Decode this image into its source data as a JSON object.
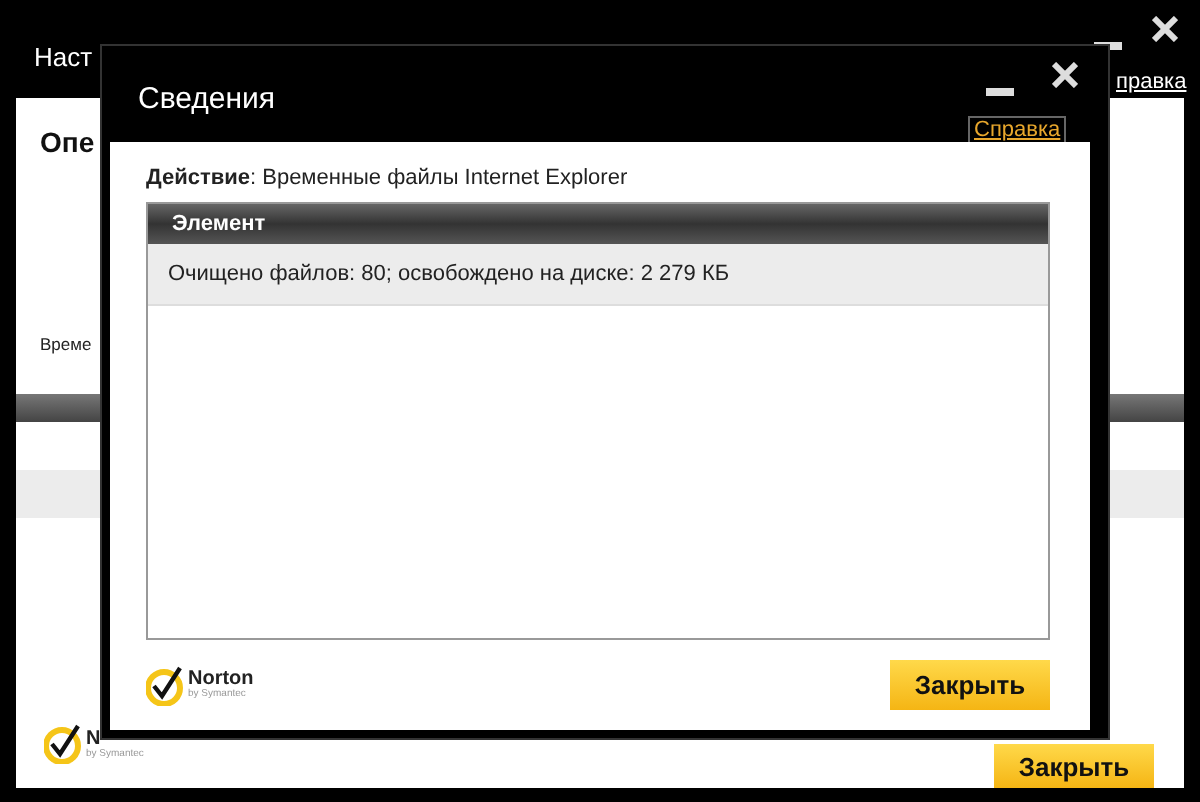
{
  "back_window": {
    "title": "Наст",
    "help_link": "правка",
    "heading": "Опе",
    "caption": "Време",
    "logo": {
      "name": "N",
      "byline": "by Symantec"
    },
    "close_button": "Закрыть"
  },
  "dialog": {
    "title": "Сведения",
    "help_link": "Справка",
    "action_label": "Действие",
    "action_value": ": Временные файлы Internet Explorer",
    "table": {
      "columns": [
        "Элемент"
      ],
      "rows": [
        {
          "cells": [
            "Очищено файлов: 80; освобождено на диске: 2 279 КБ"
          ],
          "selected": true
        }
      ]
    },
    "logo": {
      "name": "Norton",
      "byline": "by Symantec"
    },
    "close_button": "Закрыть"
  }
}
